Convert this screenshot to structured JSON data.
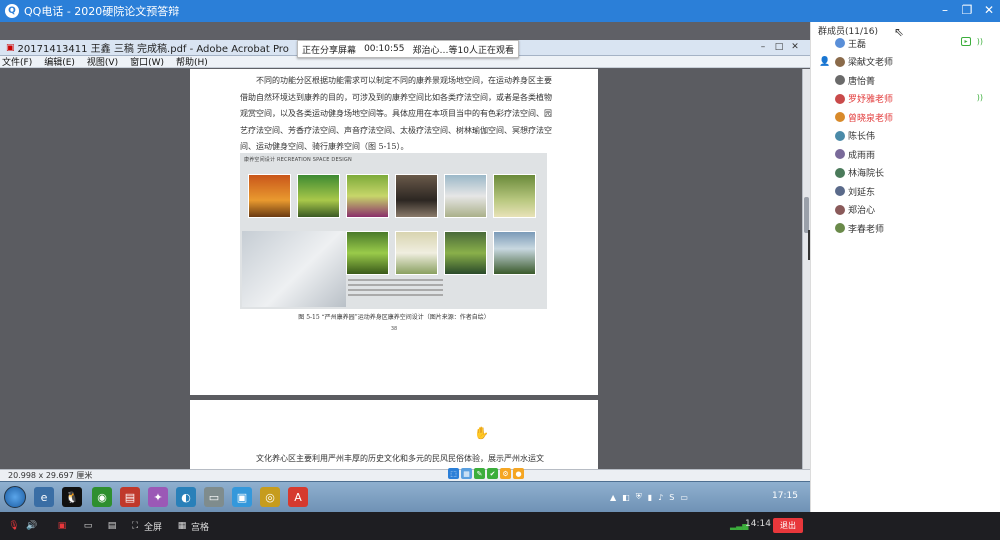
{
  "window": {
    "title": "QQ电话 - 2020硬院论文预答辩"
  },
  "share_banner": {
    "status": "正在分享屏幕",
    "time": "00:10:55",
    "viewers": "郑治心…等10人正在观看"
  },
  "acrobat": {
    "title": "20171413411 王鑫 三稿 完成稿.pdf - Adobe Acrobat Pro",
    "menu": [
      "文件(F)",
      "编辑(E)",
      "视图(V)",
      "窗口(W)",
      "帮助(H)"
    ],
    "page_size": "20.998 x 29.697 厘米"
  },
  "document": {
    "paragraph1": "不同的功能分区根据功能需求可以制定不同的康养景观场地空间，在运动养身区主要借助自然环境达到康养的目的，可涉及到的康养空间比如各类疗法空间，或者是各类植物观赏空间，以及各类运动健身场地空间等。具体应用在本项目当中的有色彩疗法空间、园艺疗法空间、芳香疗法空间、声音疗法空间、太极疗法空间、树林瑜伽空间、冥想疗法空间、运动健身空间、骑行康养空间（图 5-15）。",
    "figure_header": "康养空间设计  RECREATION SPACE DESIGN",
    "figure_caption": "图 5-15 “严州康养园”运动养身区康养空间设计（图片来源：作者自绘）",
    "page_number": "38",
    "paragraph2": "文化养心区主要利用严州丰厚的历史文化和多元的民风民俗体验，展示严州水运文化、梅城古镇历史文化、三江口渔文化、以及严东关敬中和百年老字号五加皮酒文化等场地空间。另外有针对性的举办一些环境教育、植物教育、康养知识教育讲座。"
  },
  "taskbar": {
    "clock": "17:15"
  },
  "members": {
    "header": "群成员(11/16)",
    "list": [
      {
        "name": "王磊",
        "color": "#333333",
        "host": false,
        "mic": true,
        "video": true
      },
      {
        "name": "梁献文老师",
        "color": "#333333",
        "host": true,
        "mic": false,
        "video": false
      },
      {
        "name": "唐怡菁",
        "color": "#333333",
        "host": false,
        "mic": false,
        "video": false
      },
      {
        "name": "罗妤雅老师",
        "color": "#e23b3b",
        "host": false,
        "mic": true,
        "video": false
      },
      {
        "name": "曾晓泉老师",
        "color": "#e23b3b",
        "host": false,
        "mic": false,
        "video": false
      },
      {
        "name": "陈长伟",
        "color": "#333333",
        "host": false,
        "mic": false,
        "video": false
      },
      {
        "name": "成雨雨",
        "color": "#333333",
        "host": false,
        "mic": false,
        "video": false
      },
      {
        "name": "林海院长",
        "color": "#333333",
        "host": false,
        "mic": false,
        "video": false
      },
      {
        "name": "刘延东",
        "color": "#333333",
        "host": false,
        "mic": false,
        "video": false
      },
      {
        "name": "郑治心",
        "color": "#333333",
        "host": false,
        "mic": false,
        "video": false
      },
      {
        "name": "李春老师",
        "color": "#333333",
        "host": false,
        "mic": false,
        "video": false
      }
    ]
  },
  "bottom_bar": {
    "fullscreen": "全屏",
    "gallery": "宫格",
    "call_time": "14:14",
    "exit": "退出"
  }
}
